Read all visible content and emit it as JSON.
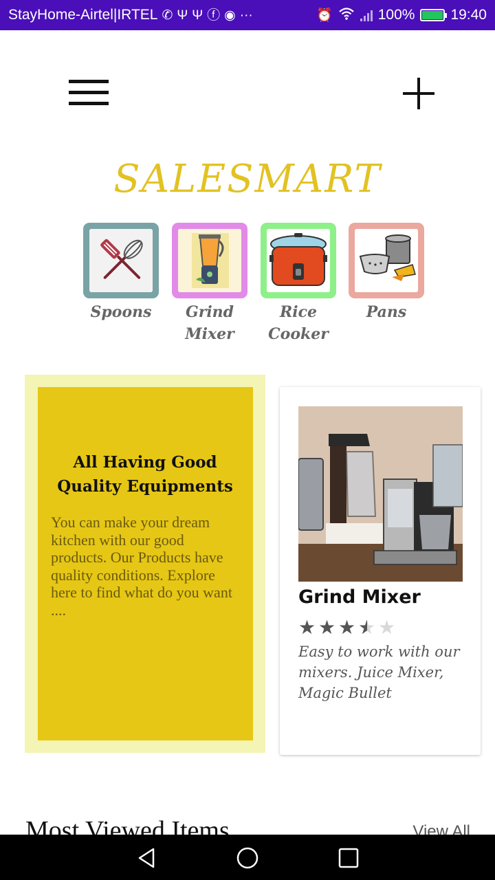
{
  "status_bar": {
    "carrier": "StayHome-Airtel|IRTEL",
    "battery": "100%",
    "battery_level": 1.0,
    "time": "19:40",
    "icons": [
      "phone-icon",
      "usb-icon",
      "usb-icon",
      "facebook-icon",
      "messenger-icon",
      "more-icon",
      "alarm-icon",
      "wifi-icon",
      "signal-icon",
      "battery-icon"
    ]
  },
  "toolbar": {
    "menu_icon": "hamburger-menu-icon",
    "add_icon": "plus-icon"
  },
  "brand": {
    "title": "SALESMART",
    "color": "#e2c223"
  },
  "categories": [
    {
      "label": "Spoons",
      "icon": "spatula-whisk-icon",
      "border_color": "#7aa3a6"
    },
    {
      "label": "Grind Mixer",
      "icon": "blender-icon",
      "border_color": "#e28ae8"
    },
    {
      "label": "Rice Cooker",
      "icon": "rice-cooker-icon",
      "border_color": "#8ef088"
    },
    {
      "label": "Pans",
      "icon": "pans-icon",
      "border_color": "#eba89e"
    }
  ],
  "promo": {
    "title": "All Having Good Quality Equipments",
    "text": "You can make your dream kitchen with our good products. Our Products have quality conditions. Explore here to find what do you want ....",
    "outer_color": "#f4f4b4",
    "inner_color": "#e6c715"
  },
  "product": {
    "name": "Grind Mixer",
    "rating": 3.5,
    "rating_max": 5,
    "description": "Easy to work with our mixers. Juice Mixer, Magic Bullet",
    "image": "coffee-machine-photo"
  },
  "most_viewed": {
    "title": "Most Viewed Items",
    "link": "View All"
  },
  "nav": {
    "back": "back-triangle-icon",
    "home": "home-circle-icon",
    "recent": "recent-square-icon"
  }
}
